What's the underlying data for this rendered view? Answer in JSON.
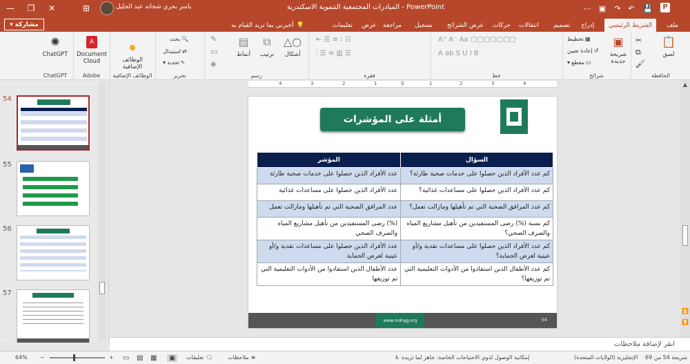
{
  "titlebar": {
    "app_name": "PowerPoint",
    "doc_title": "المبادرات المجتمعية التنموية الاسكندرية - PowerPoint",
    "user_name": "ياسر بحري شحاته عبد الجليل",
    "minimize": "—",
    "maximize": "❐",
    "close": "✕",
    "qa_save": "💾",
    "qa_undo": "↶",
    "qa_redo": "↷"
  },
  "tabs": {
    "file": "ملف",
    "home": "الشريط الرئيسي",
    "insert": "إدراج",
    "design": "تصميم",
    "transitions": "انتقالات",
    "animations": "حركات",
    "slideshow": "عرض الشرائح",
    "record": "تسجيل",
    "review": "مراجعة",
    "view": "عرض",
    "help": "تعليمات",
    "tell_me": "أخبرني بما تريد القيام به",
    "share": "مشاركة"
  },
  "ribbon": {
    "clipboard": {
      "label": "الحافظة",
      "paste": "لصق"
    },
    "slides": {
      "label": "شرائح",
      "new_slide": "شريحة جديدة",
      "layout": "تخطيط",
      "reset": "إعادة تعيين",
      "section": "مقطع"
    },
    "font": {
      "label": "خط"
    },
    "paragraph": {
      "label": "فقرة"
    },
    "drawing": {
      "label": "رسم",
      "shapes": "أشكال",
      "arrange": "ترتيب",
      "styles": "أنماط"
    },
    "editing": {
      "label": "تحرير",
      "find": "بحث",
      "replace": "استبدال",
      "select": "تحديد"
    },
    "addins": {
      "label": "الوظائف الإضافية",
      "addins_btn": "الوظائف الإضافية"
    },
    "adobe": {
      "label": "Adobe",
      "document_cloud": "Document Cloud"
    },
    "chatgpt": {
      "label": "ChatGPT",
      "chatgpt_btn": "ChatGPT"
    }
  },
  "thumbnails": [
    {
      "number": "54",
      "current": true
    },
    {
      "number": "55",
      "current": false
    },
    {
      "number": "56",
      "current": false
    },
    {
      "number": "57",
      "current": false
    }
  ],
  "ruler": [
    "4",
    "3",
    "2",
    "1",
    "0",
    "1",
    "2",
    "3",
    "4"
  ],
  "slide": {
    "title": "أمثلة على المؤشرات",
    "table": {
      "headers": [
        "السؤال",
        "المؤشر"
      ],
      "rows": [
        [
          "كم عدد الأفراد الذين حصلوا على خدمات صحية طارئة؟",
          "عدد الأفراد الذين حصلوا على خدمات صحية طارئة"
        ],
        [
          "كم عدد الأفراد الذين حصلوا على مساعدات غذائية؟",
          "عدد الأفراد الذين حصلوا على مساعدات غذائية"
        ],
        [
          "كم عدد المرافق الصحية التي تم تأهيلها ومازالت تعمل؟",
          "عدد المرافق الصحية التي تم تأهيلها ومازالت تعمل"
        ],
        [
          "كم نسبة (%) رضى المستفيدين من تأهيل مشاريع المياه والصرف الصحي؟",
          "(%) رضى المستفيدين من تأهيل مشاريع المياه والصرف الصحي"
        ],
        [
          "كم عدد الأفراد الذين حصلوا على مساعدات نقدية و/أو عينية لغرض الحماية؟",
          "عدد الأفراد الذين حصلوا على مساعدات نقدية و/أو عينية لغرض الحماية"
        ],
        [
          "كم عدد الأطفال الذين استفادوا من الأدوات التعليمية التي تم توزيعها؟",
          "عدد الأطفال الذين استفادوا من الأدوات التعليمية التي تم توزيعها"
        ]
      ]
    },
    "footer_url": "www.mdrajg.org",
    "page_number": "54"
  },
  "notes": {
    "placeholder": "انقر لإضافة ملاحظات"
  },
  "status": {
    "slide_position": "شريحة 54 من 69",
    "language": "الإنجليزية (الولايات المتحدة)",
    "accessibility": "إمكانية الوصول لذوي الاحتياجات الخاصة: جاهز لما تريده",
    "notes_btn": "ملاحظات",
    "comments_btn": "تعليقات",
    "zoom": "64%"
  }
}
